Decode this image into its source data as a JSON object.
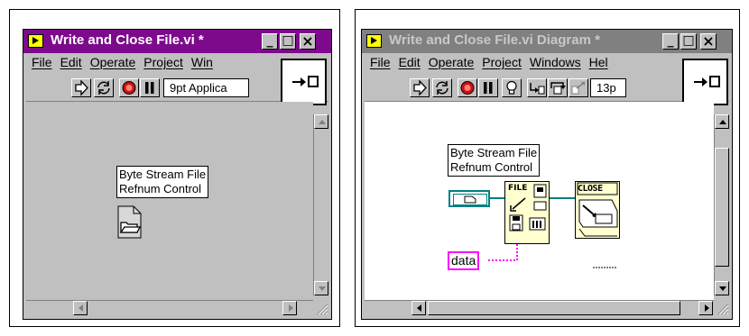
{
  "front_panel": {
    "title": "Write and Close File.vi *",
    "menu": [
      "File",
      "Edit",
      "Operate",
      "Project",
      "Win"
    ],
    "font_selector": "9pt Applica",
    "control_label": [
      "Byte Stream File",
      "Refnum Control"
    ],
    "title_bar_color": "#7d0a8c",
    "canvas_color": "#c0c0c0"
  },
  "diagram": {
    "title": "Write and Close File.vi Diagram *",
    "menu": [
      "File",
      "Edit",
      "Operate",
      "Project",
      "Windows",
      "Hel"
    ],
    "font_selector": "13p",
    "terminal_label": [
      "Byte Stream File",
      "Refnum Control"
    ],
    "data_label": "data",
    "write_node_text": "FILE",
    "close_node_text": "CLOSE",
    "refnum_wire_color": "#008080",
    "string_wire_color": "#ff00ff"
  },
  "caption_buttons": {
    "minimize": "_",
    "maximize": "□",
    "close": "×"
  },
  "icons": [
    "run-arrow-icon",
    "run-continuous-icon",
    "abort-icon",
    "pause-icon",
    "highlight-bulb-icon",
    "step-into-icon",
    "step-over-icon",
    "step-out-icon",
    "connector-pane-icon",
    "folder-icon",
    "resize-grip-icon"
  ]
}
